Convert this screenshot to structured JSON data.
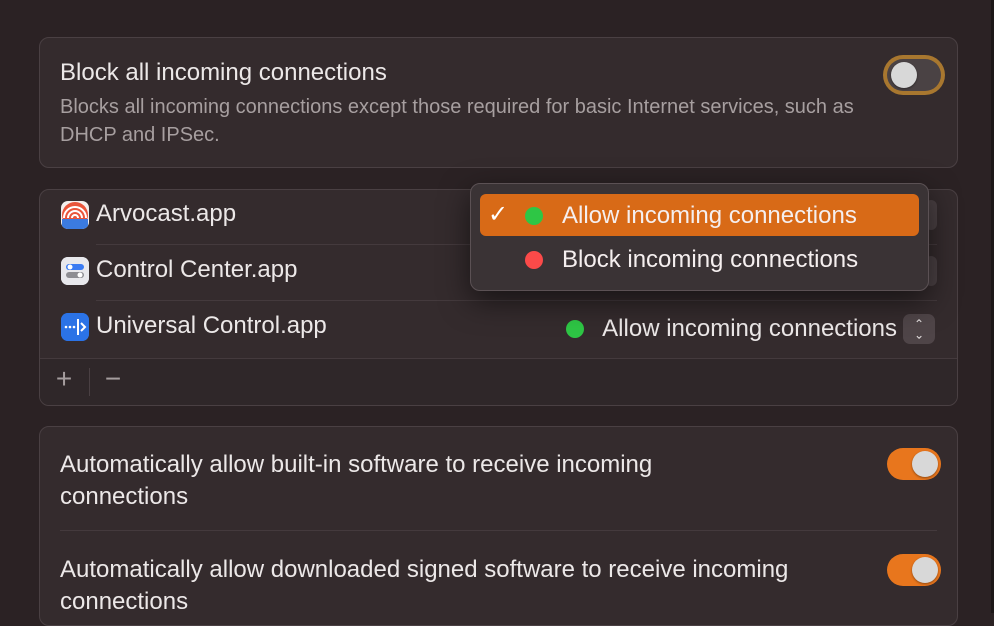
{
  "block_all": {
    "title": "Block all incoming connections",
    "description": "Blocks all incoming connections except those required for basic Internet services, such as DHCP and IPSec.",
    "enabled": false
  },
  "apps": [
    {
      "name": "Arvocast.app",
      "icon": "arvocast-app-icon",
      "status": "Allow incoming connections"
    },
    {
      "name": "Control Center.app",
      "icon": "control-center-app-icon",
      "status": "Block incoming connections"
    },
    {
      "name": "Universal Control.app",
      "icon": "universal-control-app-icon",
      "status": "Allow incoming connections"
    }
  ],
  "list_controls": {
    "add_label": "+",
    "remove_label": "−"
  },
  "popup_menu": {
    "items": [
      {
        "label": "Allow incoming connections",
        "checked": true,
        "dot_color": "#2ec645"
      },
      {
        "label": "Block incoming connections",
        "checked": false,
        "dot_color": "#fb4a49"
      }
    ],
    "check_glyph": "✓"
  },
  "auto_settings": [
    {
      "label": "Automatically allow built-in software to receive incoming connections",
      "enabled": true
    },
    {
      "label": "Automatically allow downloaded signed software to receive incoming connections",
      "enabled": true
    }
  ],
  "colors": {
    "accent": "#e8761d",
    "allow": "#2ec645",
    "block": "#fb4a49"
  }
}
